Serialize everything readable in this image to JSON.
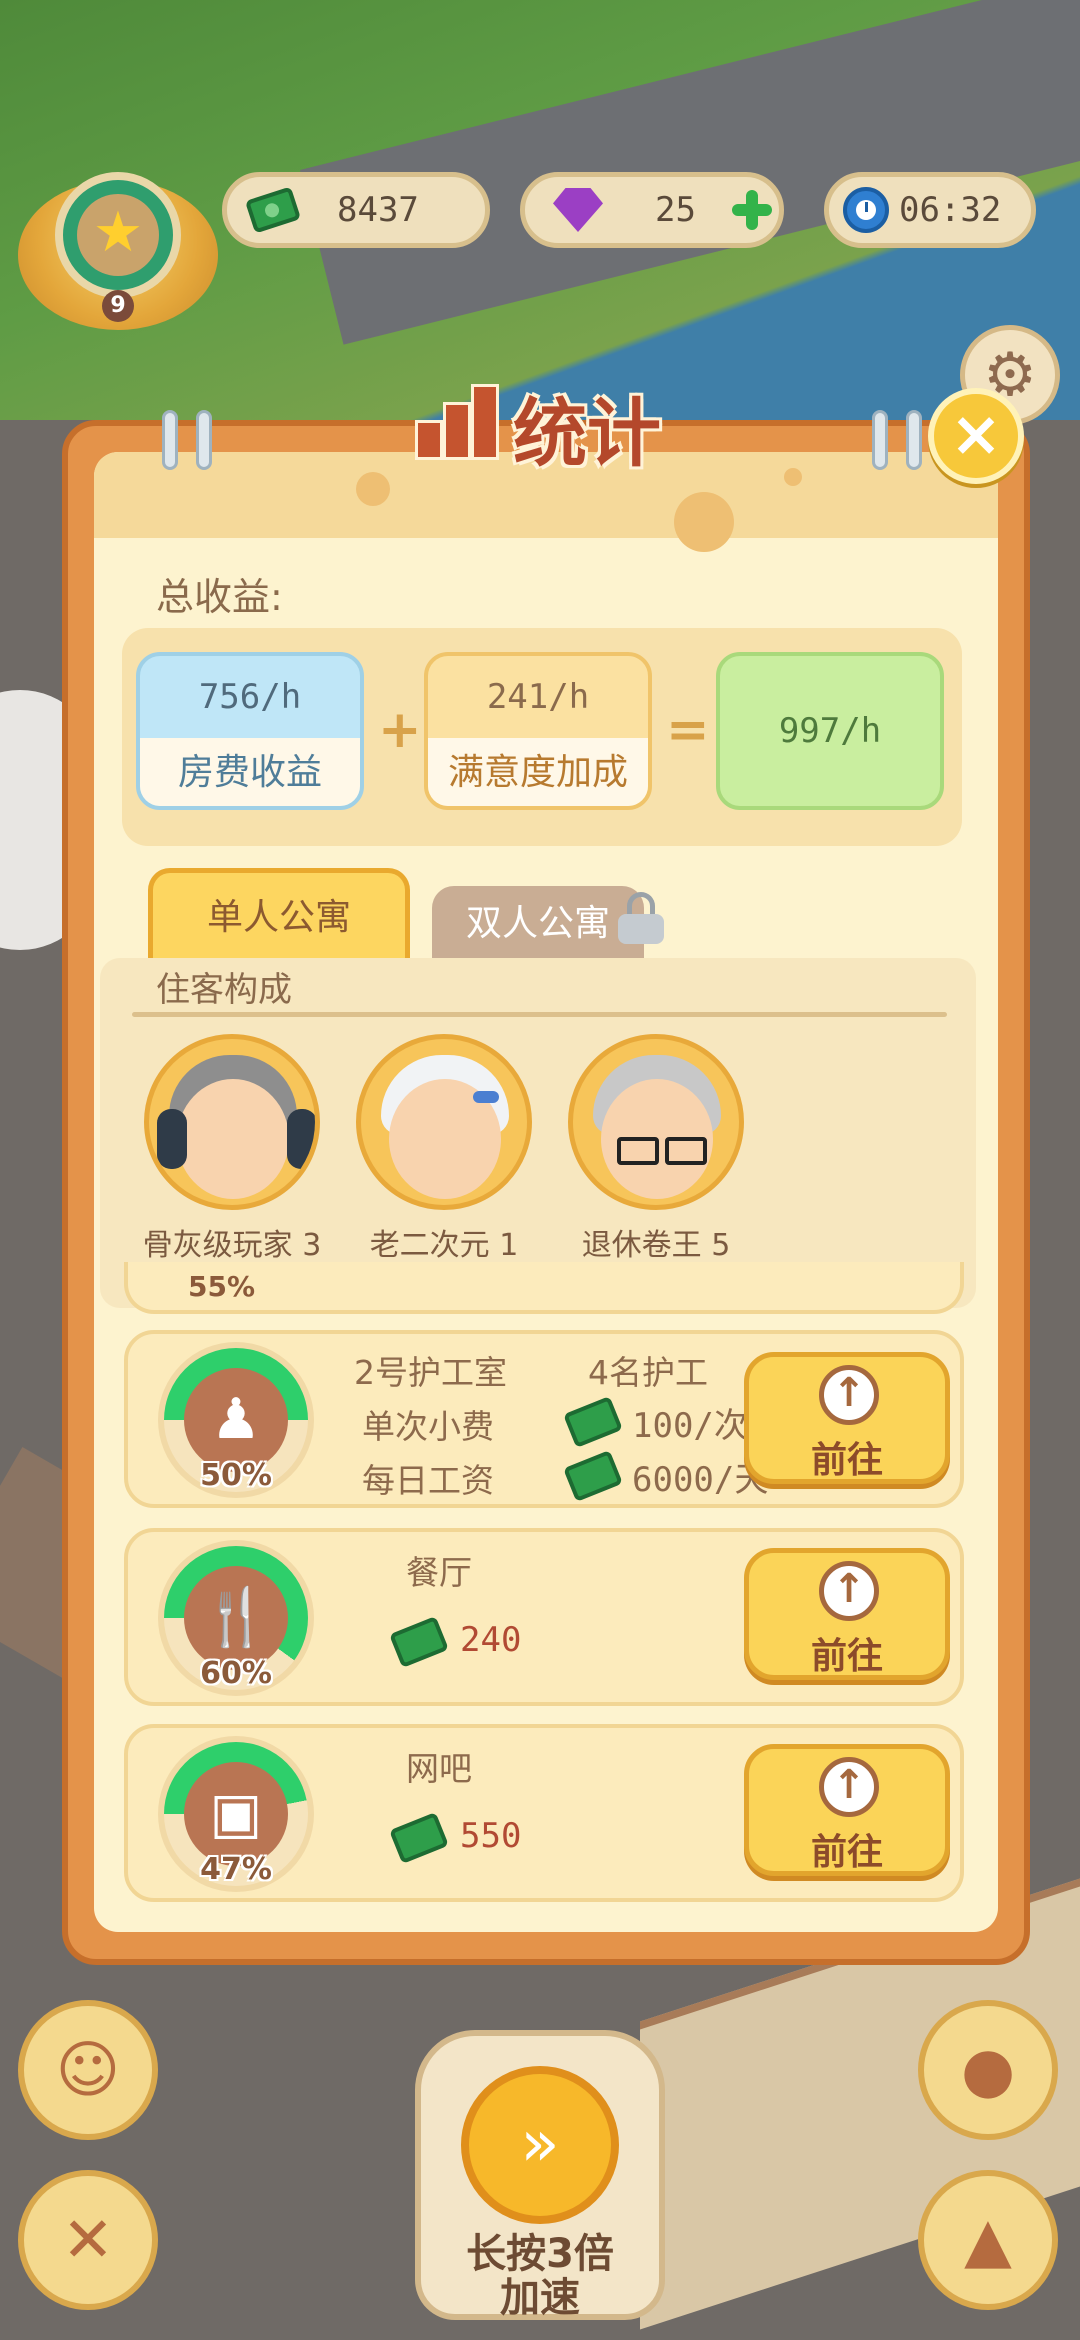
{
  "hud": {
    "level": "9",
    "cash": "8437",
    "gems": "25",
    "timer": "06:32"
  },
  "panel": {
    "title": "统计",
    "total_label": "总收益:",
    "income": {
      "rent_value": "756/h",
      "rent_label": "房费收益",
      "bonus_value": "241/h",
      "bonus_label": "满意度加成",
      "plus": "+",
      "equals": "=",
      "total_value": "997/h"
    },
    "tabs": [
      {
        "label": "单人公寓",
        "active": true,
        "locked": false
      },
      {
        "label": "双人公寓",
        "active": false,
        "locked": true
      }
    ],
    "residents_title": "住客构成",
    "residents": [
      {
        "name": "骨灰级玩家 3"
      },
      {
        "name": "老二次元 1"
      },
      {
        "name": "退休卷王 5"
      }
    ],
    "partial_pct": "55%",
    "facilities": [
      {
        "name": "2号护工室",
        "extra": "4名护工",
        "row1_label": "单次小费",
        "row1_value": "100/次",
        "row2_label": "每日工资",
        "row2_value": "6000/天",
        "percent_value": 50,
        "percent": "50%",
        "button": "前往"
      },
      {
        "name": "餐厅",
        "value": "240",
        "percent_value": 60,
        "percent": "60%",
        "button": "前往"
      },
      {
        "name": "网吧",
        "value": "550",
        "percent_value": 47,
        "percent": "47%",
        "button": "前往"
      }
    ]
  },
  "bottom": {
    "speed_line1": "长按3倍",
    "speed_line2": "加速"
  },
  "colors": {
    "panel_border": "#e4934a",
    "panel_bg": "#fdf3cf",
    "accent_red": "#b4482b",
    "gauge_green": "#2ecf6b",
    "button_yellow": "#fbd458"
  },
  "icons": [
    "level-star-icon",
    "cash-icon",
    "gem-icon",
    "plus-icon",
    "clock-icon",
    "gear-icon",
    "close-icon",
    "stats-chart-icon",
    "lock-icon",
    "nurse-icon",
    "cutlery-icon",
    "computer-icon",
    "up-arrow-icon",
    "fast-forward-icon",
    "chat-icon",
    "tools-icon",
    "fruit-icon",
    "hammer-icon"
  ]
}
